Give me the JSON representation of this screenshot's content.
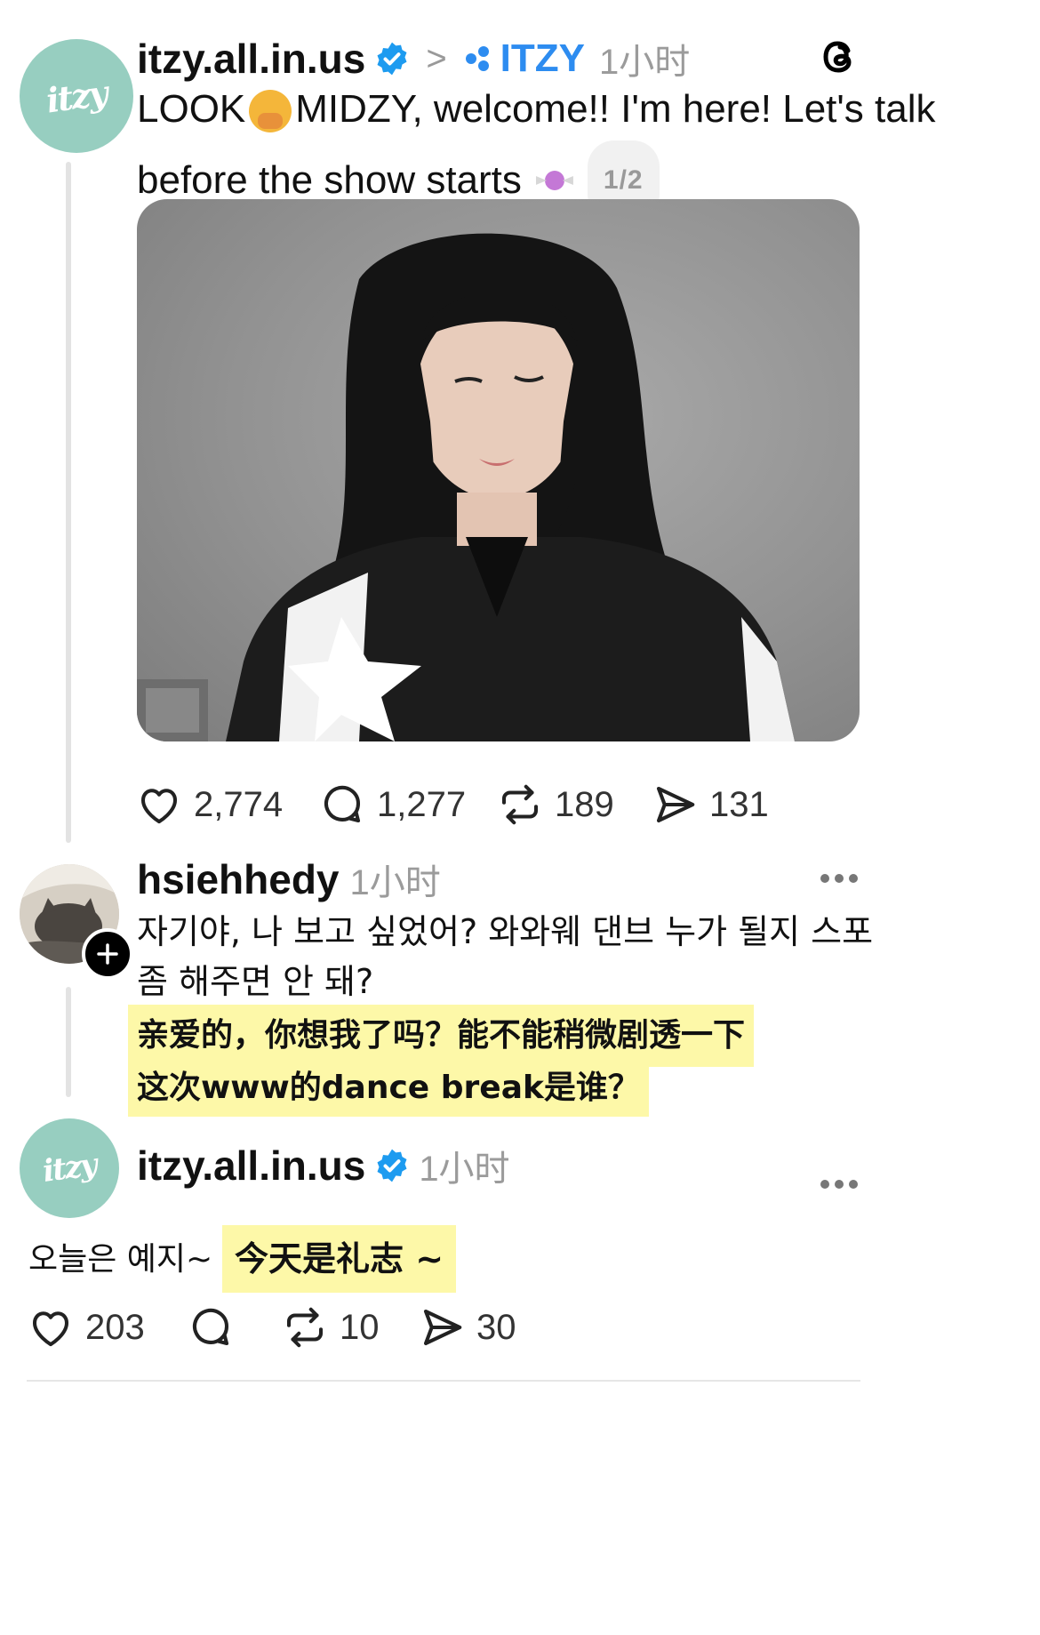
{
  "post": {
    "username": "itzy.all.in.us",
    "separator": ">",
    "community": "ITZY",
    "time": "1小时",
    "text_line1": "LOOK",
    "text_line1b": "MIDZY, welcome!! I'm here! Let's talk",
    "text_line2": "before the show starts",
    "page_indicator": "1/2",
    "avatar_text": "itzy",
    "metrics": {
      "likes": "2,774",
      "comments": "1,277",
      "reposts": "189",
      "shares": "131"
    }
  },
  "reply1": {
    "username": "hsiehhedy",
    "time": "1小时",
    "text_line1": "자기야, 나 보고 싶었어? 와와웨 댄브 누가 될지 스포",
    "text_line2": "좀 해주면 안 돼?",
    "translation_line1": "亲爱的，你想我了吗？能不能稍微剧透一下",
    "translation_line2": "这次www的dance break是谁？"
  },
  "reply2": {
    "username": "itzy.all.in.us",
    "time": "1小时",
    "avatar_text": "itzy",
    "text": "오늘은 예지~",
    "translation": "今天是礼志 ~",
    "metrics": {
      "likes": "203",
      "reposts": "10",
      "shares": "30"
    }
  },
  "colors": {
    "verified": "#1d9bf0",
    "community": "#2d8cf0",
    "highlight": "#fdf8a8",
    "avatar_bg": "#97cec0"
  },
  "icons": [
    "threads-icon",
    "verified-icon",
    "heart-icon",
    "comment-icon",
    "repost-icon",
    "share-icon",
    "follow-plus-icon",
    "more-icon"
  ]
}
